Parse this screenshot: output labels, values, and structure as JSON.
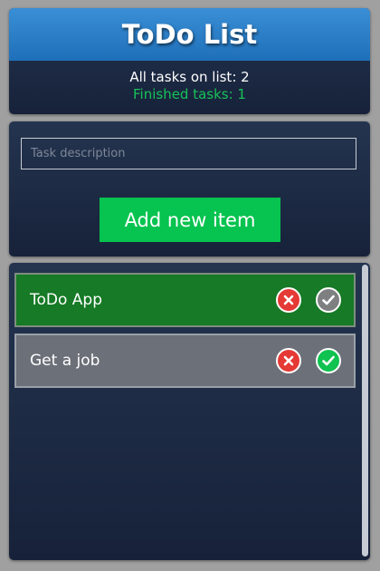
{
  "header": {
    "title": "ToDo List",
    "all_tasks_text": "All tasks on list: 2",
    "finished_tasks_text": "Finished tasks: 1"
  },
  "form": {
    "input_value": "",
    "input_placeholder": "Task description",
    "add_button_label": "Add new item"
  },
  "tasks": [
    {
      "label": "ToDo App",
      "finished": true
    },
    {
      "label": "Get a job",
      "finished": false
    }
  ],
  "icons": {
    "delete": "close-icon",
    "complete": "check-icon"
  },
  "colors": {
    "header_blue": "#2b80cc",
    "accent_green": "#07c34f",
    "finished_row": "#167a26",
    "open_row": "#6c7078",
    "delete_red": "#e53935"
  }
}
